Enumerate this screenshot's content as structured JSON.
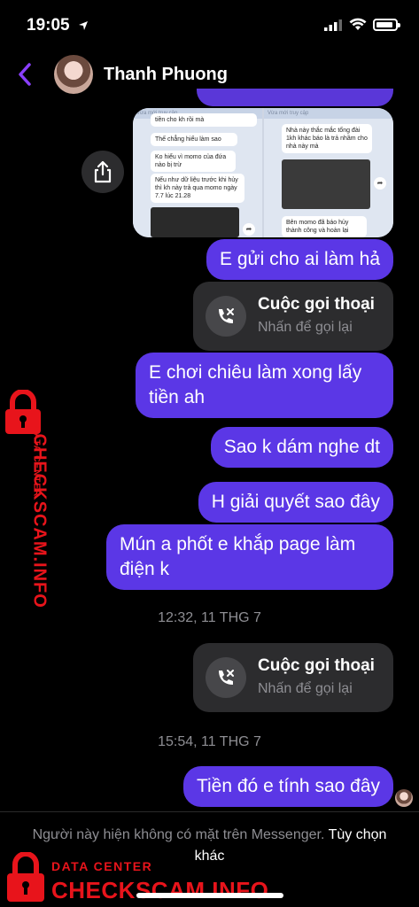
{
  "status": {
    "time": "19:05"
  },
  "header": {
    "name": "Thanh Phuong"
  },
  "screenshots": {
    "left": {
      "bar": "Vừa mới truy cập",
      "lines": [
        "tiền cho kh rồi mà",
        "Thế chẳng hiểu làm sao",
        "Ko hiểu vì momo của đứa nào bị trừ",
        "Nếu như dữ liệu trước khi hủy thì kh này trả qua momo ngày 7.7 lúc 21.28"
      ]
    },
    "right": {
      "bar": "Vừa mới truy cập",
      "lines": [
        "Nhà này thắc mắc tổng đài 1kh khác báo là trả nhầm cho nhà này mà",
        "Bên momo đã báo hủy thành công và hoàn lại"
      ]
    }
  },
  "messages": [
    {
      "text": "E gửi cho ai làm hả"
    },
    {
      "text": "E chơi chiêu làm xong lấy tiền ah"
    },
    {
      "text": "Sao k dám nghe dt"
    },
    {
      "text": "H giải quyết sao đây"
    },
    {
      "text": "Mún a phốt e khắp page làm điện k"
    },
    {
      "text": "Tiền đó e tính sao đây"
    }
  ],
  "calls": [
    {
      "title": "Cuộc gọi thoại",
      "subtitle": "Nhấn để gọi lại"
    },
    {
      "title": "Cuộc gọi thoại",
      "subtitle": "Nhấn để gọi lại"
    }
  ],
  "timestamps": [
    "12:32, 11 THG 7",
    "15:54, 11 THG 7"
  ],
  "footer": {
    "text": "Người này hiện không có mặt trên Messenger.",
    "option": "Tùy chọn khác"
  },
  "watermark": {
    "small": "DATA CENTER",
    "big": "CHECKSCAM.INFO"
  },
  "colors": {
    "bubble": "#5b37e6",
    "accent": "#8a3ffc",
    "watermark": "#e8141b"
  }
}
